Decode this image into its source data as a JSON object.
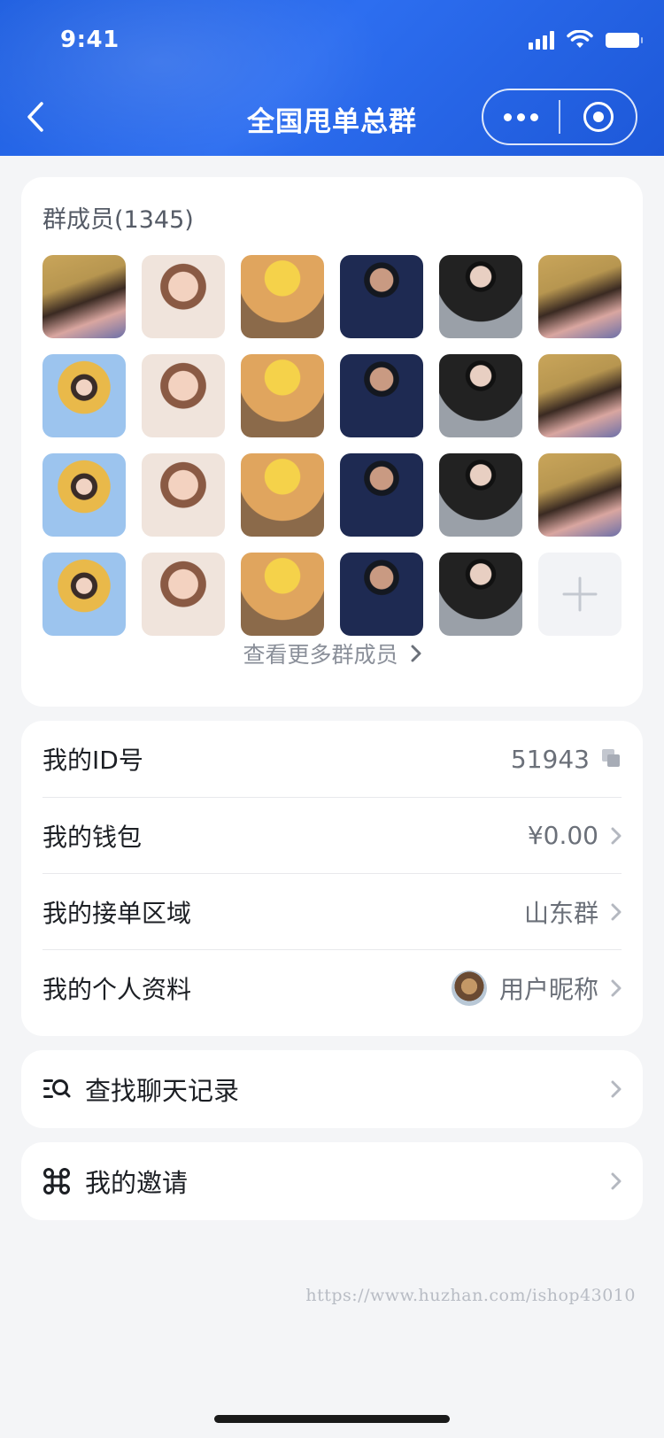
{
  "status_bar": {
    "time": "9:41"
  },
  "nav": {
    "title": "全国甩单总群"
  },
  "members": {
    "title": "群成员(1345)",
    "rows": [
      [
        0,
        1,
        2,
        3,
        4,
        0
      ],
      [
        5,
        1,
        2,
        3,
        4,
        0
      ],
      [
        5,
        1,
        2,
        3,
        4,
        0
      ],
      [
        5,
        1,
        2,
        3,
        4
      ]
    ],
    "more_label": "查看更多群成员"
  },
  "info": [
    {
      "key": "id",
      "label": "我的ID号",
      "value": "51943"
    },
    {
      "key": "wallet",
      "label": "我的钱包",
      "value": "¥0.00"
    },
    {
      "key": "region",
      "label": "我的接单区域",
      "value": "山东群"
    },
    {
      "key": "profile",
      "label": "我的个人资料",
      "value": "用户昵称"
    }
  ],
  "actions": {
    "search_history": "查找聊天记录",
    "invite": "我的邀请"
  },
  "watermark": "https://www.huzhan.com/ishop43010"
}
